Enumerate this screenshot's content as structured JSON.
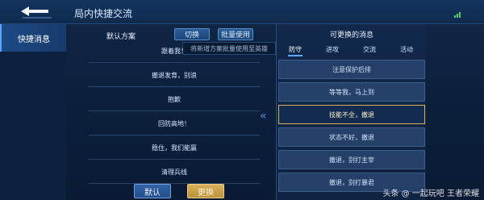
{
  "topbar": {
    "title": "局内快捷交流",
    "back_icon": "back-arrow-icon",
    "signal_icon": "signal-icon"
  },
  "sidebar": {
    "items": [
      {
        "label": "快捷消息",
        "active": true
      }
    ]
  },
  "left_panel": {
    "title": "默认方案",
    "switch_label": "切换",
    "batch_label": "批量使用",
    "tooltip": "将新增方案批量使用至英雄",
    "messages": [
      "跟着我！",
      "撤退发育，别浪",
      "抱歉",
      "回防高地！",
      "稳住，我们能赢",
      "清理兵线"
    ],
    "buttons": {
      "default": "默认",
      "replace": "更换"
    }
  },
  "right_panel": {
    "title": "可更换的消息",
    "tabs": [
      "防守",
      "进攻",
      "交流",
      "活动"
    ],
    "active_tab": 0,
    "options": [
      {
        "label": "注意保护后排",
        "selected": false
      },
      {
        "label": "等等我，马上到",
        "selected": false
      },
      {
        "label": "技能不全，撤退",
        "selected": true
      },
      {
        "label": "状态不好，撤退",
        "selected": false
      },
      {
        "label": "撤退，别打主宰",
        "selected": false
      },
      {
        "label": "撤退，别打暴君",
        "selected": false
      }
    ]
  },
  "footer": {
    "text": "头条 @ 一起玩吧 王者荣耀"
  },
  "colors": {
    "accent_blue": "#59a7ff",
    "selected_gold": "#d9b15b"
  }
}
